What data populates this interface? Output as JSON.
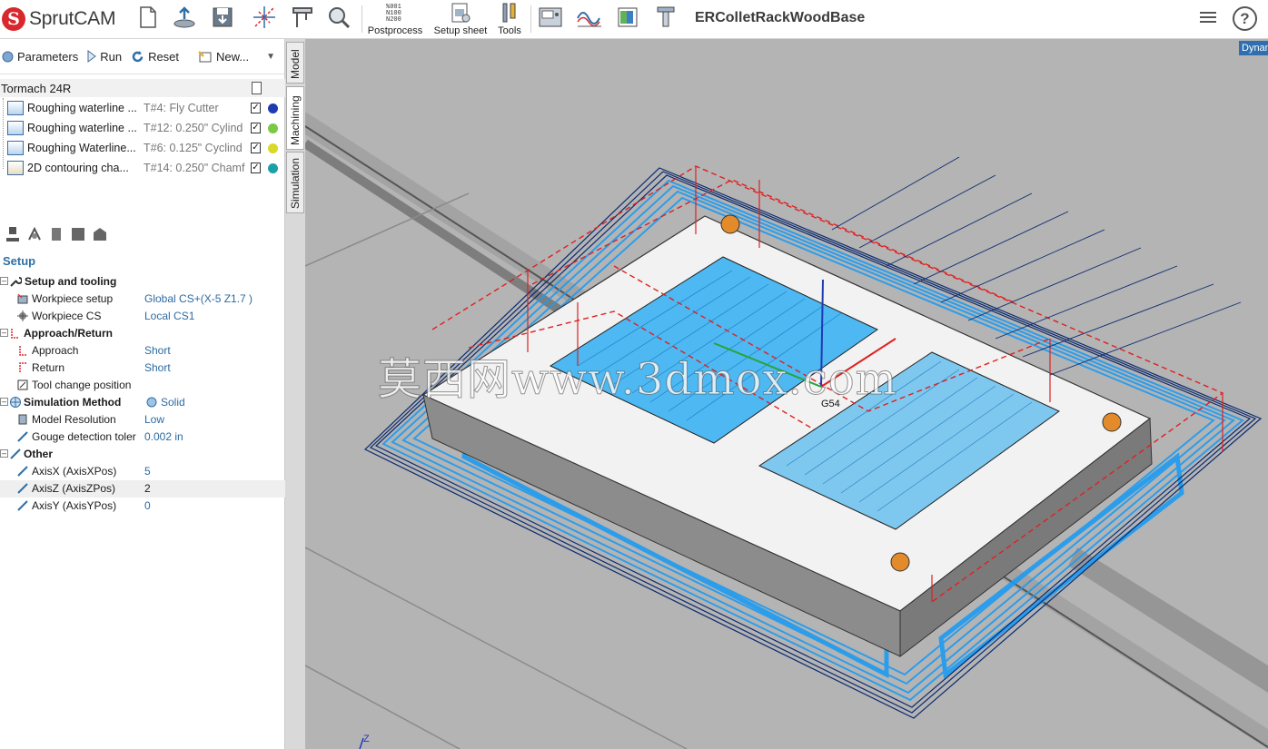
{
  "app": {
    "logo_text": "SprutCAM",
    "project_title": "ERColletRackWoodBase"
  },
  "toolbar": {
    "postprocess_label": "Postprocess",
    "setup_sheet_label": "Setup sheet",
    "tools_label": "Tools",
    "postprocess_glyph_lines": [
      "%001",
      "N100",
      "N200"
    ]
  },
  "left_panel": {
    "commands": {
      "parameters": "Parameters",
      "run": "Run",
      "reset": "Reset",
      "new": "New..."
    },
    "machine": "Tormach 24R",
    "operations": [
      {
        "name": "Roughing waterline ...",
        "tool": "T#4: Fly Cutter",
        "dot_color": "#1f3bb3"
      },
      {
        "name": "Roughing waterline ...",
        "tool": "T#12: 0.250\" Cylind",
        "dot_color": "#7ac943"
      },
      {
        "name": "Roughing Waterline...",
        "tool": "T#6: 0.125\" Cyclind",
        "dot_color": "#d9d92a"
      },
      {
        "name": "2D contouring cha...",
        "tool": "T#14: 0.250\" Chamf",
        "dot_color": "#1aa0a8"
      }
    ],
    "setup_heading": "Setup",
    "properties": {
      "setup_tooling": "Setup and tooling",
      "workpiece_setup": "Workpiece setup",
      "workpiece_setup_value": "Global CS+(X-5 Z1.7 )",
      "workpiece_cs": "Workpiece CS",
      "workpiece_cs_value": "Local CS1",
      "approach_return": "Approach/Return",
      "approach": "Approach",
      "approach_value": "Short",
      "return": "Return",
      "return_value": "Short",
      "tool_change": "Tool change position",
      "simulation_method": "Simulation Method",
      "simulation_method_value": "Solid",
      "model_resolution": "Model Resolution",
      "model_resolution_value": "Low",
      "gouge": "Gouge detection toler",
      "gouge_value": "0.002 in",
      "other": "Other",
      "axis_x": "AxisX (AxisXPos)",
      "axis_x_value": "5",
      "axis_z": "AxisZ (AxisZPos)",
      "axis_z_value": "2",
      "axis_y": "AxisY (AxisYPos)",
      "axis_y_value": "0"
    }
  },
  "side_tabs": {
    "model": "Model",
    "machining": "Machining",
    "simulation": "Simulation"
  },
  "viewport": {
    "dynamic_button": "Dynam",
    "watermark": "莫西网www.3dmox.com",
    "cs_label": "G54",
    "axis_z_label": "Z"
  },
  "colors": {
    "toolpath_blue": "#1e9bf0",
    "toolpath_dark": "#0b2a6e",
    "approach_red": "#e02020",
    "brand_red": "#d9272e",
    "accent_blue": "#2e6fa6"
  }
}
